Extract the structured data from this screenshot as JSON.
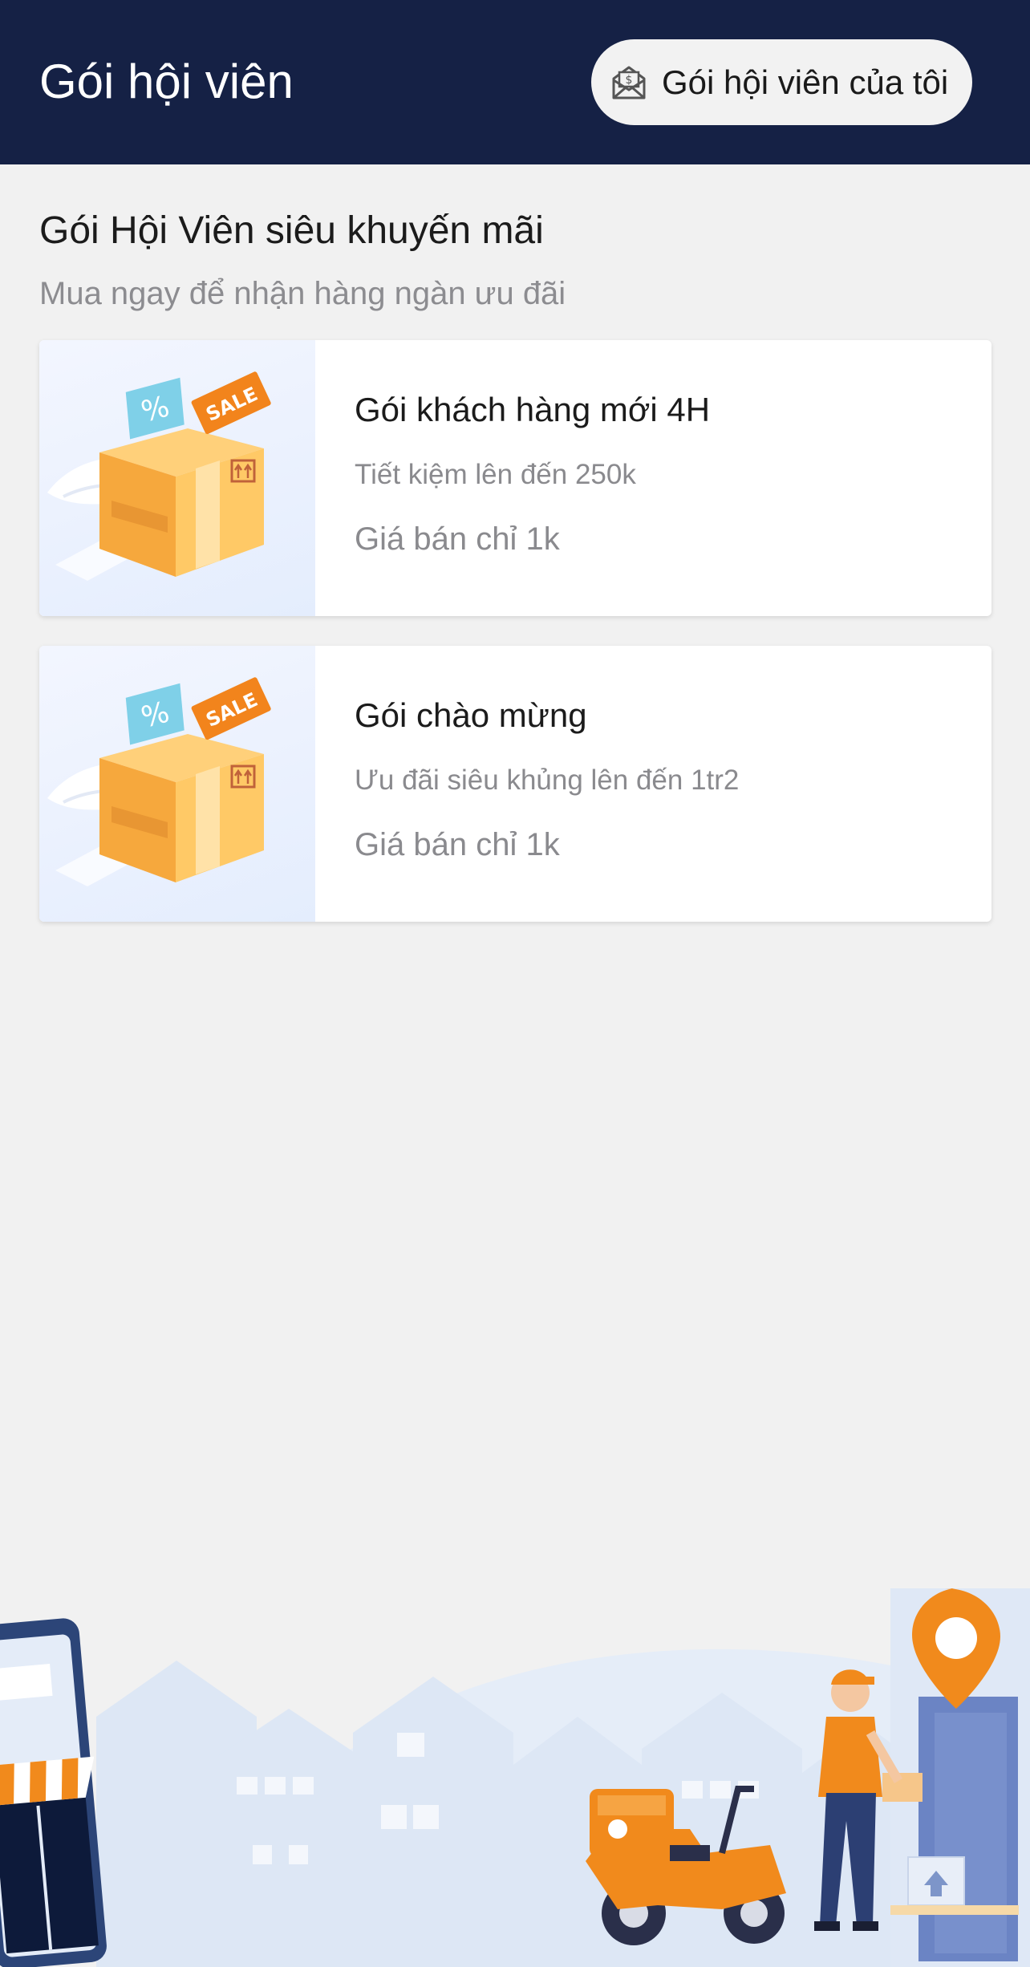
{
  "header": {
    "title": "Gói hội viên",
    "my_packages_label": "Gói hội viên của tôi",
    "my_packages_icon": "envelope-dollar-icon",
    "bg_color": "#152145"
  },
  "section": {
    "title": "Gói Hội Viên siêu khuyến mãi",
    "subtitle": "Mua ngay để nhận hàng ngàn ưu đãi"
  },
  "packages": [
    {
      "name": "Gói khách hàng mới 4H",
      "description": "Tiết kiệm lên đến 250k",
      "price": "Giá bán chỉ 1k",
      "image_icon": "flying-sale-box-icon"
    },
    {
      "name": "Gói chào mừng",
      "description": "Ưu đãi siêu khủng lên đến 1tr2",
      "price": "Giá bán chỉ 1k",
      "image_icon": "flying-sale-box-icon"
    }
  ],
  "illustration": {
    "icon": "delivery-city-illustration",
    "accent_color": "#f18a1c"
  }
}
